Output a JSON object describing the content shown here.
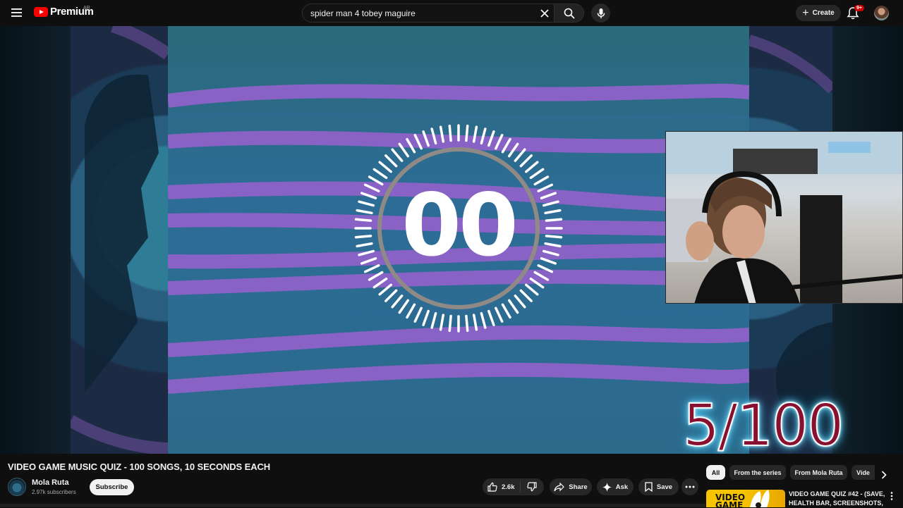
{
  "header": {
    "logo_text": "Premium",
    "country_code": "AR",
    "search_value": "spider man 4 tobey maguire",
    "create_label": "Create",
    "notification_badge": "9+"
  },
  "player": {
    "countdown_text": "00",
    "score_text": "5/100"
  },
  "video": {
    "title": "VIDEO GAME MUSIC QUIZ - 100 SONGS, 10 SECONDS EACH",
    "channel_name": "Mola Ruta",
    "subscribers": "2.97k subscribers",
    "subscribe_label": "Subscribe",
    "like_count": "2.6k",
    "share_label": "Share",
    "ask_label": "Ask",
    "save_label": "Save"
  },
  "sidebar": {
    "chips": [
      "All",
      "From the series",
      "From Mola Ruta",
      "Vide"
    ],
    "recommendation": {
      "title": "VIDEO GAME QUIZ #42 - (SAVE, HEALTH BAR, SCREENSHOTS, ...",
      "thumb_text_1": "VIDEO",
      "thumb_text_2": "GAME"
    }
  },
  "colors": {
    "brand_red": "#ff0000",
    "badge_red": "#cc0000",
    "wave_purple": "#8e62c8",
    "wave_blue": "#2d6c96",
    "score_color": "#8a1030"
  }
}
